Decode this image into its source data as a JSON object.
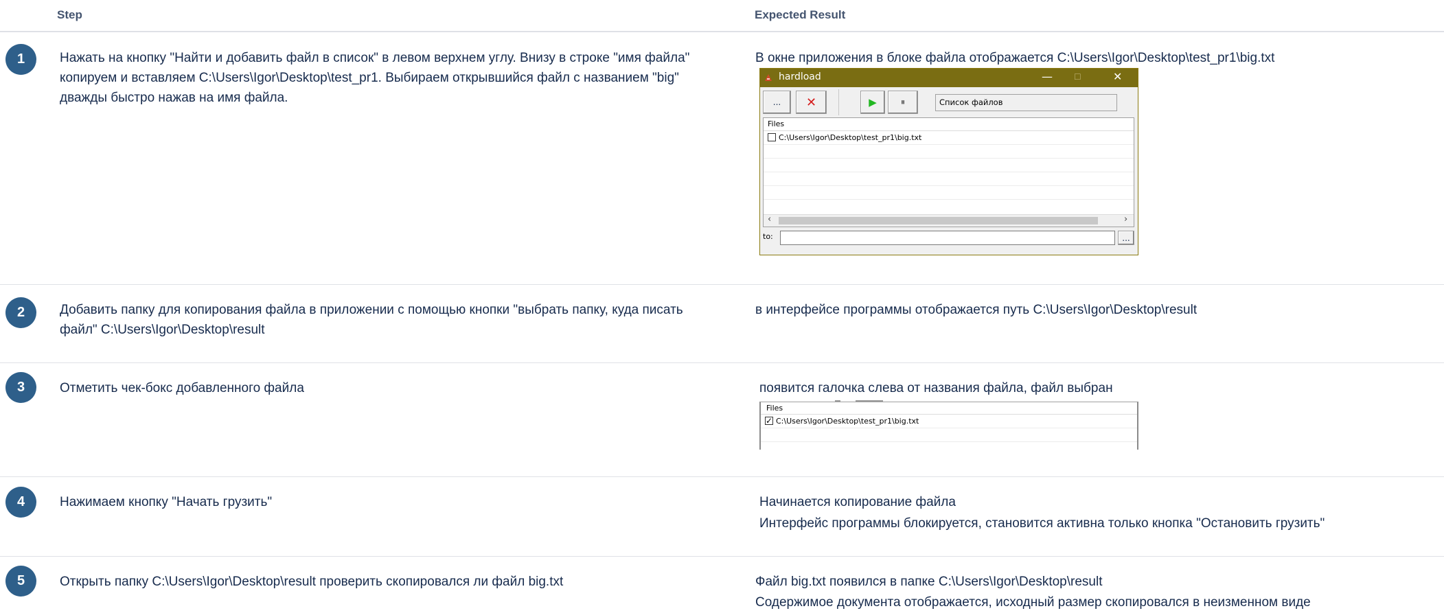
{
  "headers": {
    "step": "Step",
    "expected": "Expected Result"
  },
  "rows": [
    {
      "num": "1",
      "step_text": "Нажать на кнопку \"Найти и добавить файл в список\" в левом верхнем углу. Внизу в строке \"имя файла\" копируем и вставляем C:\\Users\\Igor\\Desktop\\test_pr1. Выбираем открывшийся файл с названием \"big\" дважды быстро нажав на имя файла.",
      "expected_text": "В окне приложения в блоке файла отображается C:\\Users\\Igor\\Desktop\\test_pr1\\big.txt"
    },
    {
      "num": "2",
      "step_text": "Добавить папку для копирования файла в приложении с помощью кнопки \"выбрать папку, куда писать файл\" C:\\Users\\Igor\\Desktop\\result",
      "expected_text": "в интерфейсе программы отображается путь C:\\Users\\Igor\\Desktop\\result"
    },
    {
      "num": "3",
      "step_text": "Отметить чек-бокс добавленного файла",
      "expected_text": "появится галочка слева от названия файла, файл выбран"
    },
    {
      "num": "4",
      "step_text": "Нажимаем кнопку \"Начать грузить\"",
      "expected_line1": "Начинается копирование файла",
      "expected_line2": "Интерфейс программы блокируется, становится активна только кнопка \"Остановить грузить\""
    },
    {
      "num": "5",
      "step_text": "Открыть папку C:\\Users\\Igor\\Desktop\\result проверить скопировался ли файл big.txt",
      "expected_line1": "Файл big.txt появился в папке C:\\Users\\Igor\\Desktop\\result",
      "expected_line2": "Содержимое документа отображается, исходный размер скопировался в неизменном виде"
    }
  ],
  "app_window": {
    "title": "hardload",
    "minimize": "—",
    "maximize": "☐",
    "close": "✕",
    "browse_button": "...",
    "remove_button": "✕",
    "start_button": "▶",
    "pause_button": "⏸",
    "status_field": "Список файлов",
    "list_header": "Files",
    "file_entry": "C:\\Users\\Igor\\Desktop\\test_pr1\\big.txt",
    "scroll_left": "‹",
    "scroll_right": "›",
    "to_label": "to:",
    "to_browse_button": "...",
    "colors": {
      "titlebar": "#7a6d12",
      "start_green": "#22b722",
      "remove_red": "#d41c1c"
    }
  },
  "crop_screenshot": {
    "list_header": "Files",
    "file_entry": "C:\\Users\\Igor\\Desktop\\test_pr1\\big.txt",
    "checked": true
  },
  "colors": {
    "step_circle": "#2e5f8a",
    "text": "#172b4d",
    "header_text": "#44546f",
    "divider": "#dfe1e6"
  }
}
